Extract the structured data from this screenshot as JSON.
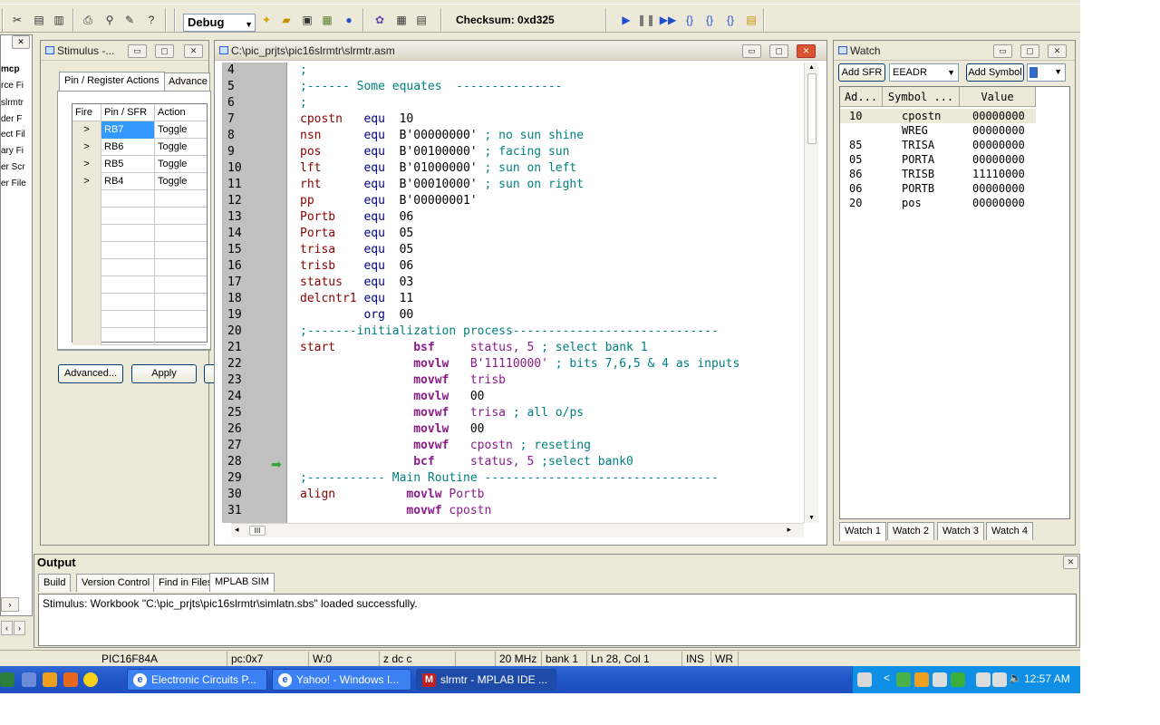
{
  "toolbar": {
    "config_select": "Debug",
    "checksum": "Checksum: 0xd325"
  },
  "project": {
    "items": [
      "mcp",
      "rce Fi",
      "slrmtr",
      "der F",
      "ect Fil",
      "ary Fi",
      "er Scr",
      "er File"
    ]
  },
  "stimulus": {
    "title": "Stimulus -...",
    "tabs": [
      "Pin / Register Actions",
      "Advance"
    ],
    "columns": [
      "Fire",
      "Pin / SFR",
      "Action"
    ],
    "fire_symbol": ">",
    "rows": [
      {
        "pin": "RB7",
        "action": "Toggle"
      },
      {
        "pin": "RB6",
        "action": "Toggle"
      },
      {
        "pin": "RB5",
        "action": "Toggle"
      },
      {
        "pin": "RB4",
        "action": "Toggle"
      }
    ],
    "advanced_label": "Advanced...",
    "apply_label": "Apply"
  },
  "editor": {
    "title": "C:\\pic_prjts\\pic16slrmtr\\slrmtr.asm",
    "lines": [
      {
        "n": "4",
        "parts": [
          [
            "c-cmt",
            ";"
          ]
        ]
      },
      {
        "n": "5",
        "parts": [
          [
            "c-cmt",
            ";------ Some equates  ---------------"
          ]
        ]
      },
      {
        "n": "6",
        "parts": [
          [
            "c-cmt",
            ";"
          ]
        ]
      },
      {
        "n": "7",
        "parts": [
          [
            "c-id",
            "cpostn"
          ],
          [
            "c-kw",
            "   equ"
          ],
          [
            "c-num",
            "  10"
          ]
        ]
      },
      {
        "n": "8",
        "parts": [
          [
            "c-id",
            "nsn"
          ],
          [
            "c-kw",
            "      equ"
          ],
          [
            "c-num",
            "  B'00000000'"
          ],
          [
            "c-cmt",
            " ; no sun shine"
          ]
        ]
      },
      {
        "n": "9",
        "parts": [
          [
            "c-id",
            "pos"
          ],
          [
            "c-kw",
            "      equ"
          ],
          [
            "c-num",
            "  B'00100000'"
          ],
          [
            "c-cmt",
            " ; facing sun"
          ]
        ]
      },
      {
        "n": "10",
        "parts": [
          [
            "c-id",
            "lft"
          ],
          [
            "c-kw",
            "      equ"
          ],
          [
            "c-num",
            "  B'01000000'"
          ],
          [
            "c-cmt",
            " ; sun on left"
          ]
        ]
      },
      {
        "n": "11",
        "parts": [
          [
            "c-id",
            "rht"
          ],
          [
            "c-kw",
            "      equ"
          ],
          [
            "c-num",
            "  B'00010000'"
          ],
          [
            "c-cmt",
            " ; sun on right"
          ]
        ]
      },
      {
        "n": "12",
        "parts": [
          [
            "c-id",
            "pp"
          ],
          [
            "c-kw",
            "       equ"
          ],
          [
            "c-num",
            "  B'00000001'"
          ]
        ]
      },
      {
        "n": "13",
        "parts": [
          [
            "c-id",
            "Portb"
          ],
          [
            "c-kw",
            "    equ"
          ],
          [
            "c-num",
            "  06"
          ]
        ]
      },
      {
        "n": "14",
        "parts": [
          [
            "c-id",
            "Porta"
          ],
          [
            "c-kw",
            "    equ"
          ],
          [
            "c-num",
            "  05"
          ]
        ]
      },
      {
        "n": "15",
        "parts": [
          [
            "c-id",
            "trisa"
          ],
          [
            "c-kw",
            "    equ"
          ],
          [
            "c-num",
            "  05"
          ]
        ]
      },
      {
        "n": "16",
        "parts": [
          [
            "c-id",
            "trisb"
          ],
          [
            "c-kw",
            "    equ"
          ],
          [
            "c-num",
            "  06"
          ]
        ]
      },
      {
        "n": "17",
        "parts": [
          [
            "c-id",
            "status"
          ],
          [
            "c-kw",
            "   equ"
          ],
          [
            "c-num",
            "  03"
          ]
        ]
      },
      {
        "n": "18",
        "parts": [
          [
            "c-id",
            "delcntr1"
          ],
          [
            "c-kw",
            " equ"
          ],
          [
            "c-num",
            "  11"
          ]
        ]
      },
      {
        "n": "19",
        "parts": [
          [
            "c-kw",
            "         org"
          ],
          [
            "c-num",
            "  00"
          ]
        ]
      },
      {
        "n": "20",
        "parts": [
          [
            "c-cmt",
            ";-------initialization process-----------------------------"
          ]
        ]
      },
      {
        "n": "21",
        "parts": [
          [
            "c-id",
            "start"
          ],
          [
            "c-ins",
            "           bsf"
          ],
          [
            "c-op",
            "     status, 5"
          ],
          [
            "c-cmt",
            " ; select bank 1"
          ]
        ]
      },
      {
        "n": "22",
        "parts": [
          [
            "c-ins",
            "                movlw"
          ],
          [
            "c-op",
            "   B'11110000'"
          ],
          [
            "c-cmt",
            " ; bits 7,6,5 & 4 as inputs"
          ]
        ]
      },
      {
        "n": "23",
        "parts": [
          [
            "c-ins",
            "                movwf"
          ],
          [
            "c-op",
            "   trisb"
          ]
        ]
      },
      {
        "n": "24",
        "parts": [
          [
            "c-ins",
            "                movlw"
          ],
          [
            "c-num",
            "   00"
          ]
        ]
      },
      {
        "n": "25",
        "parts": [
          [
            "c-ins",
            "                movwf"
          ],
          [
            "c-op",
            "   trisa"
          ],
          [
            "c-cmt",
            " ; all o/ps"
          ]
        ]
      },
      {
        "n": "26",
        "parts": [
          [
            "c-ins",
            "                movlw"
          ],
          [
            "c-num",
            "   00"
          ]
        ]
      },
      {
        "n": "27",
        "parts": [
          [
            "c-ins",
            "                movwf"
          ],
          [
            "c-op",
            "   cpostn"
          ],
          [
            "c-cmt",
            " ; reseting"
          ]
        ]
      },
      {
        "n": "28",
        "parts": [
          [
            "c-ins",
            "                bcf"
          ],
          [
            "c-op",
            "     status, 5"
          ],
          [
            "c-cmt",
            " ;select bank0"
          ]
        ]
      },
      {
        "n": "29",
        "parts": [
          [
            "c-cmt",
            ";----------- Main Routine ---------------------------------"
          ]
        ]
      },
      {
        "n": "30",
        "parts": [
          [
            "c-id",
            "align"
          ],
          [
            "c-ins",
            "          movlw"
          ],
          [
            "c-op",
            " Portb"
          ]
        ]
      },
      {
        "n": "31",
        "parts": [
          [
            "c-ins",
            "               movwf"
          ],
          [
            "c-op",
            " cpostn"
          ]
        ]
      }
    ],
    "hscroll_thumb": "III"
  },
  "watch": {
    "title": "Watch",
    "add_sfr_label": "Add SFR",
    "sfr_select": "EEADR",
    "add_symbol_label": "Add Symbol",
    "columns": [
      "Ad...",
      "Symbol ...",
      "Value"
    ],
    "rows": [
      {
        "addr": "10",
        "symbol": "cpostn",
        "value": "00000000"
      },
      {
        "addr": "",
        "symbol": "WREG",
        "value": "00000000"
      },
      {
        "addr": "85",
        "symbol": "TRISA",
        "value": "00000000"
      },
      {
        "addr": "05",
        "symbol": "PORTA",
        "value": "00000000"
      },
      {
        "addr": "86",
        "symbol": "TRISB",
        "value": "11110000"
      },
      {
        "addr": "06",
        "symbol": "PORTB",
        "value": "00000000"
      },
      {
        "addr": "20",
        "symbol": "pos",
        "value": "00000000"
      }
    ],
    "tabs": [
      "Watch 1",
      "Watch 2",
      "Watch 3",
      "Watch 4"
    ]
  },
  "output": {
    "title": "Output",
    "tabs": [
      "Build",
      "Version Control",
      "Find in Files",
      "MPLAB SIM"
    ],
    "message": "Stimulus: Workbook \"C:\\pic_prjts\\pic16slrmtr\\simlatn.sbs\" loaded successfully."
  },
  "status": {
    "device": "PIC16F84A",
    "pc": "pc:0x7",
    "w": "W:0",
    "flags": "z dc c",
    "freq": "20 MHz",
    "bank": "bank 1",
    "position": "Ln 28, Col 1",
    "ins": "INS",
    "wr": "WR"
  },
  "taskbar": {
    "tasks": [
      "Electronic Circuits P...",
      "Yahoo! - Windows I...",
      "slrmtr - MPLAB IDE ..."
    ],
    "clock": "12:57 AM"
  }
}
